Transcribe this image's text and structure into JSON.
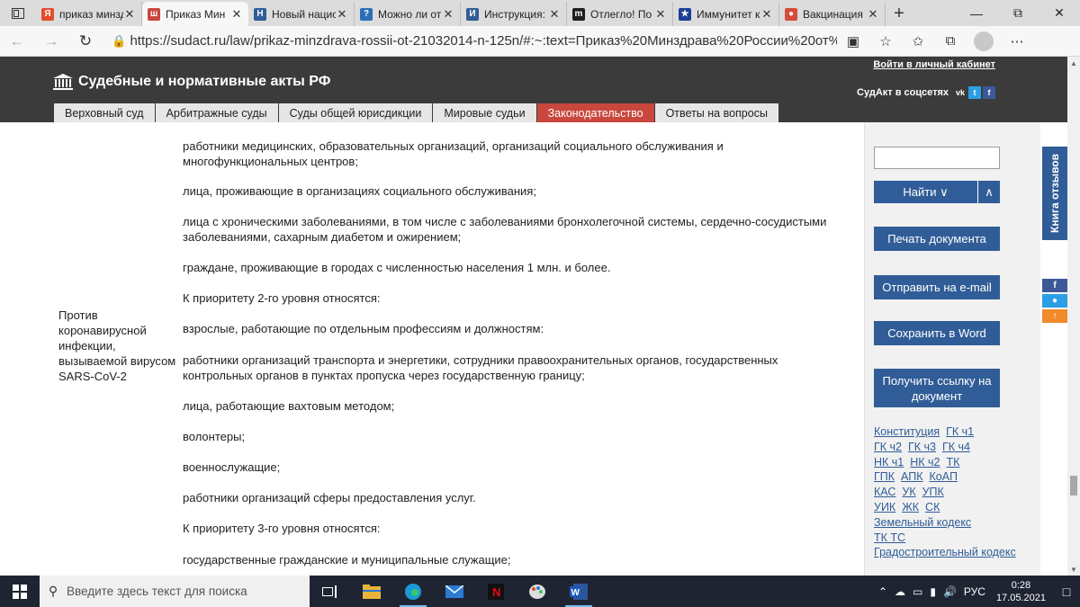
{
  "browser": {
    "tabs": [
      {
        "title": "приказ минзд",
        "favicon": "yandex-icon",
        "color": "#e34b2d",
        "glyph": "Я",
        "active": false
      },
      {
        "title": "Приказ Мин",
        "favicon": "sudact-icon",
        "color": "#c9473d",
        "glyph": "ш",
        "active": true
      },
      {
        "title": "Новый нацис",
        "favicon": "news-icon",
        "color": "#305d97",
        "glyph": "Н",
        "active": false
      },
      {
        "title": "Можно ли от",
        "favicon": "globe-icon",
        "color": "#2a6fb5",
        "glyph": "?",
        "active": false
      },
      {
        "title": "Инструкция:",
        "favicon": "doc-icon",
        "color": "#305d97",
        "glyph": "И",
        "active": false
      },
      {
        "title": "Отлегло! По",
        "favicon": "m-icon",
        "color": "#1e1e1e",
        "glyph": "m",
        "active": false
      },
      {
        "title": "Иммунитет к",
        "favicon": "eu-icon",
        "color": "#1c3f95",
        "glyph": "★",
        "active": false
      },
      {
        "title": "Вакцинация",
        "favicon": "chrome-icon",
        "color": "#d44c3a",
        "glyph": "●",
        "active": false
      }
    ],
    "url": "https://sudact.ru/law/prikaz-minzdrava-rossii-ot-21032014-n-125n/#:~:text=Приказ%20Минздрава%20России%20от%2021..."
  },
  "site": {
    "title": "Судебные и нормативные акты РФ",
    "login": "Войти в личный кабинет",
    "social_label": "СудАкт в соцсетях",
    "nav": [
      {
        "label": "Верховный суд",
        "active": false
      },
      {
        "label": "Арбитражные суды",
        "active": false
      },
      {
        "label": "Суды общей юрисдикции",
        "active": false
      },
      {
        "label": "Мировые судьи",
        "active": false
      },
      {
        "label": "Законодательство",
        "active": true
      },
      {
        "label": "Ответы на вопросы",
        "active": false
      }
    ]
  },
  "document": {
    "row_label": "Против коронавирусной инфекции, вызываемой вирусом SARS-CoV-2",
    "paragraphs": [
      "работники медицинских, образовательных организаций, организаций социального обслуживания и многофункциональных центров;",
      "лица, проживающие в организациях социального обслуживания;",
      "лица с хроническими заболеваниями, в том числе с заболеваниями бронхолегочной системы, сердечно-сосудистыми заболеваниями, сахарным диабетом и ожирением;",
      "граждане, проживающие в городах с численностью населения 1 млн. и более.",
      "К приоритету 2-го уровня относятся:",
      "взрослые, работающие по отдельным профессиям и должностям:",
      "работники организаций транспорта и энергетики, сотрудники правоохранительных органов, государственных контрольных органов в пунктах пропуска через государственную границу;",
      "лица, работающие вахтовым методом;",
      "волонтеры;",
      "военнослужащие;",
      "работники организаций сферы предоставления услуг.",
      "К приоритету 3-го уровня относятся:",
      "государственные гражданские и муниципальные служащие;"
    ]
  },
  "sidebar": {
    "search_value": "",
    "find_label": "Найти ∨",
    "find_up": "∧",
    "print_label": "Печать документа",
    "email_label": "Отправить на e-mail",
    "word_label": "Сохранить в Word",
    "link_label": "Получить ссылку на документ",
    "codes": [
      [
        "Конституция",
        "ГК ч1"
      ],
      [
        "ГК ч2",
        "ГК ч3",
        "ГК ч4"
      ],
      [
        "НК ч1",
        "НК ч2",
        "ТК"
      ],
      [
        "ГПК",
        "АПК",
        "КоАП"
      ],
      [
        "КАС",
        "УК",
        "УПК"
      ],
      [
        "УИК",
        "ЖК",
        "СК"
      ],
      [
        "Земельный кодекс"
      ],
      [
        "ТК ТС"
      ],
      [
        "Градостроительный кодекс"
      ]
    ],
    "feedback": "Книга отзывов"
  },
  "taskbar": {
    "search_placeholder": "Введите здесь текст для поиска",
    "lang": "РУС",
    "time": "0:28",
    "date": "17.05.2021",
    "notifications": "1"
  },
  "colors": {
    "header_bg": "#3b3b3b",
    "accent_blue": "#305d97",
    "active_nav": "#c9473d",
    "taskbar_bg": "#1f2433"
  }
}
